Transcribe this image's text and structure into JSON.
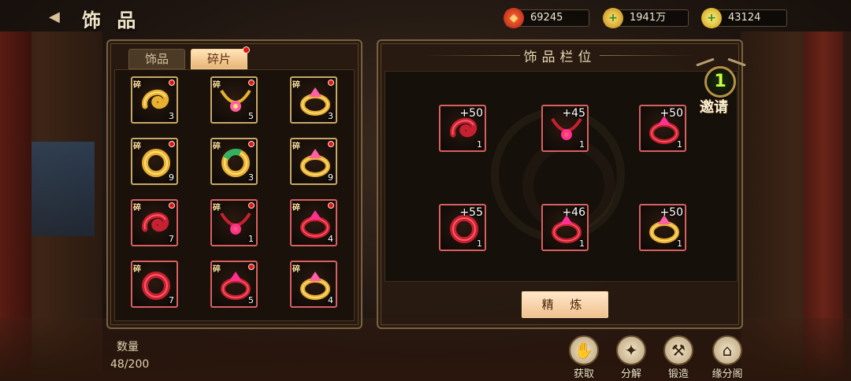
{
  "header": {
    "back_icon": "back-arrow-icon",
    "title": "饰 品",
    "currencies": [
      {
        "icon": "ruby-coin-icon",
        "value": "69245"
      },
      {
        "icon": "gold-coin-plus-icon",
        "value": "1941万"
      },
      {
        "icon": "gold-ingot-plus-icon",
        "value": "43124"
      }
    ]
  },
  "left_panel": {
    "tabs": [
      {
        "label": "饰品",
        "active": false
      },
      {
        "label": "碎片",
        "active": true,
        "has_alert": true
      }
    ],
    "fragments": [
      {
        "tag": "碎",
        "count": "3",
        "alert": true,
        "kind": "gold-swirl",
        "frame": "gold"
      },
      {
        "tag": "碎",
        "count": "5",
        "alert": true,
        "kind": "gold-necklace",
        "frame": "gold"
      },
      {
        "tag": "碎",
        "count": "3",
        "alert": true,
        "kind": "gold-ring-flower",
        "frame": "gold"
      },
      {
        "tag": "碎",
        "count": "9",
        "alert": true,
        "kind": "gold-bracelet",
        "frame": "gold"
      },
      {
        "tag": "碎",
        "count": "3",
        "alert": true,
        "kind": "jade-bracelet",
        "frame": "gold"
      },
      {
        "tag": "碎",
        "count": "9",
        "alert": true,
        "kind": "gold-ring-band",
        "frame": "gold"
      },
      {
        "tag": "碎",
        "count": "7",
        "alert": true,
        "kind": "red-swirl",
        "frame": "red"
      },
      {
        "tag": "碎",
        "count": "1",
        "alert": true,
        "kind": "red-necklace",
        "frame": "red"
      },
      {
        "tag": "碎",
        "count": "4",
        "alert": true,
        "kind": "red-ring-gem",
        "frame": "red"
      },
      {
        "tag": "碎",
        "count": "7",
        "alert": false,
        "kind": "red-bracelet",
        "frame": "red"
      },
      {
        "tag": "碎",
        "count": "5",
        "alert": true,
        "kind": "red-ring-ruby",
        "frame": "red"
      },
      {
        "tag": "碎",
        "count": "4",
        "alert": false,
        "kind": "gold-ring-pink",
        "frame": "red"
      }
    ],
    "quantity_label": "数量",
    "quantity_value": "48/200"
  },
  "right_panel": {
    "title": "饰品栏位",
    "equipped": [
      {
        "bonus": "+50",
        "count": "1",
        "kind": "red-swirl"
      },
      {
        "bonus": "+45",
        "count": "1",
        "kind": "red-necklace"
      },
      {
        "bonus": "+50",
        "count": "1",
        "kind": "red-ring-gem"
      },
      {
        "bonus": "+55",
        "count": "1",
        "kind": "red-bracelet"
      },
      {
        "bonus": "+46",
        "count": "1",
        "kind": "red-ring-ruby"
      },
      {
        "bonus": "+50",
        "count": "1",
        "kind": "gold-ring-pink"
      }
    ],
    "refine_label": "精 炼"
  },
  "invite": {
    "count": "1",
    "label": "邀请"
  },
  "actions": [
    {
      "label": "获取",
      "icon": "acquire-icon"
    },
    {
      "label": "分解",
      "icon": "decompose-icon"
    },
    {
      "label": "锻造",
      "icon": "forge-hammer-icon"
    },
    {
      "label": "缘分阁",
      "icon": "pavilion-icon"
    }
  ],
  "colors": {
    "gold_frame": "#c8a868",
    "red_frame": "#d86060",
    "alert": "#e41414",
    "tab_active": "#f0c090"
  }
}
